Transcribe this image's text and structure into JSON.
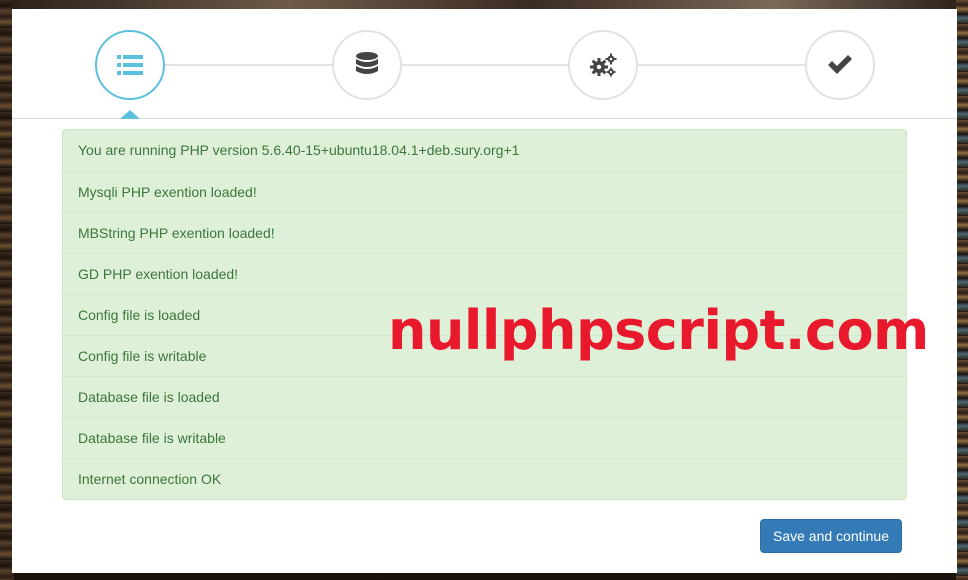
{
  "wizard": {
    "steps": [
      {
        "icon": "list-icon",
        "active": true
      },
      {
        "icon": "database-icon",
        "active": false
      },
      {
        "icon": "gears-icon",
        "active": false
      },
      {
        "icon": "checkmark-icon",
        "active": false
      }
    ],
    "active_color": "#5bc0de",
    "inactive_color": "#e2e2e2"
  },
  "checks": [
    "You are running PHP version 5.6.40-15+ubuntu18.04.1+deb.sury.org+1",
    "Mysqli PHP exention loaded!",
    "MBString PHP exention loaded!",
    "GD PHP exention loaded!",
    "Config file is loaded",
    "Config file is writable",
    "Database file is loaded",
    "Database file is writable",
    "Internet connection OK"
  ],
  "watermark": "nullphpscript.com",
  "actions": {
    "save_label": "Save and continue"
  },
  "colors": {
    "success_bg": "#dff0d8",
    "success_text": "#3c763d",
    "primary": "#337ab7",
    "watermark": "#e8192c"
  }
}
